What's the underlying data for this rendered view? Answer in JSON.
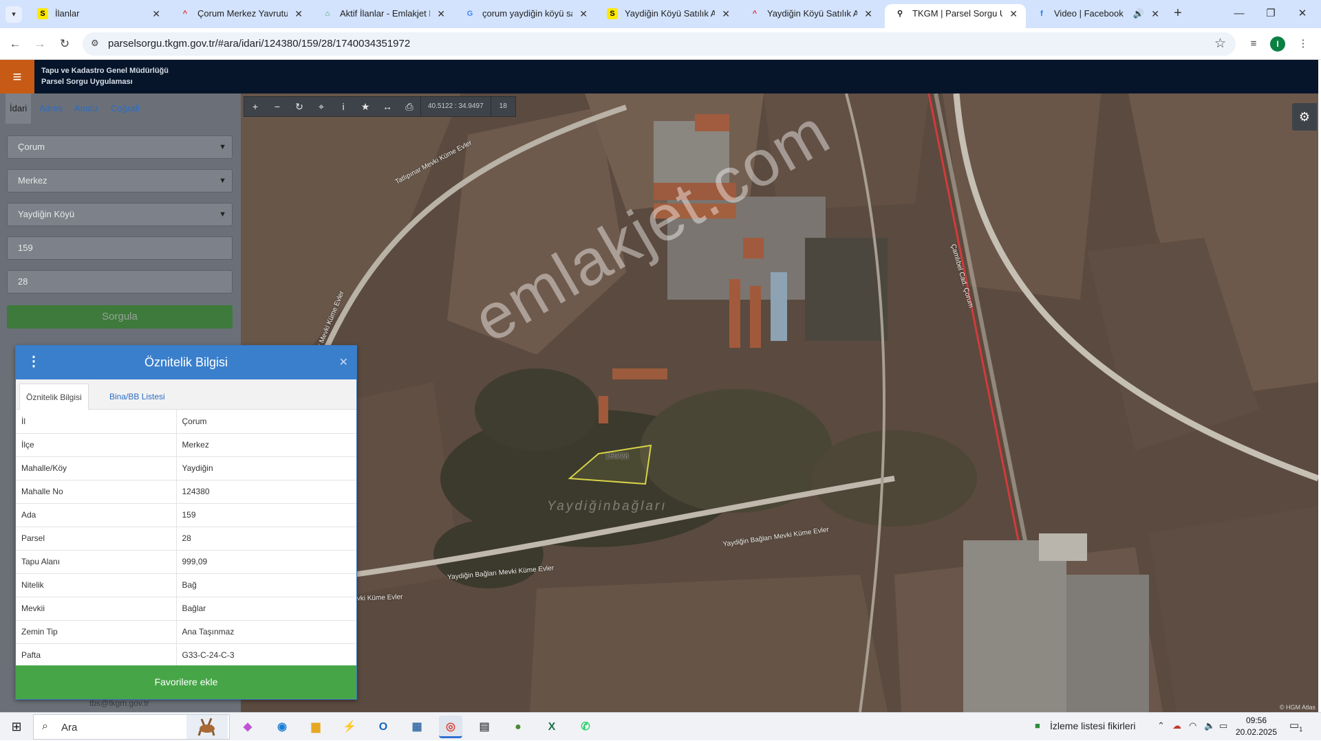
{
  "browser": {
    "tabs": [
      {
        "title": "İlanlar",
        "favicon": "sahibinden-icon",
        "fav_letter": "S",
        "fav_color": "#ffe800"
      },
      {
        "title": "Çorum Merkez Yavruturna",
        "favicon": "hepsiemlak-icon",
        "fav_letter": "^",
        "fav_color": "#e3262d"
      },
      {
        "title": "Aktif İlanlar - Emlakjet Par",
        "favicon": "emlakjet-icon",
        "fav_letter": "⌂",
        "fav_color": "#2a9d3f"
      },
      {
        "title": "çorum yaydiğin köyü satı",
        "favicon": "google-icon",
        "fav_letter": "G",
        "fav_color": "#4285f4"
      },
      {
        "title": "Yaydiğin Köyü Satılık Arsa",
        "favicon": "sahibinden-icon",
        "fav_letter": "S",
        "fav_color": "#ffe800"
      },
      {
        "title": "Yaydiğin Köyü Satılık Arsa",
        "favicon": "hepsiemlak-icon",
        "fav_letter": "^",
        "fav_color": "#e3262d"
      },
      {
        "title": "TKGM | Parsel Sorgu Uyg",
        "favicon": "location-pin-icon",
        "fav_letter": "⚲",
        "fav_color": "#1a1a1a"
      },
      {
        "title": "Video | Facebook",
        "favicon": "facebook-icon",
        "fav_letter": "f",
        "fav_color": "#1877f2"
      }
    ],
    "active_tab_index": 6,
    "url": "parselsorgu.tkgm.gov.tr/#ara/idari/124380/159/28/1740034351972",
    "profile_initial": "I"
  },
  "app": {
    "title_line1": "Tapu ve Kadastro Genel Müdürlüğü",
    "title_line2": "Parsel Sorgu Uygulaması",
    "header_color": "#07152a",
    "accent_color": "#c75b16"
  },
  "left_panel": {
    "tabs": [
      "İdari",
      "Adres",
      "Analiz",
      "Coğrafi"
    ],
    "active_tab": "İdari",
    "il": "Çorum",
    "ilce": "Merkez",
    "mahalle": "Yaydiğin Köyü",
    "ada": "159",
    "parsel": "28",
    "query_button": "Sorgula",
    "footer_link": "tbs@tkgm.gov.tr"
  },
  "map": {
    "coordinates": "40.5122 : 34.9497",
    "zoom": "18",
    "watermark": "emlakjet.com",
    "parcel_label": "159/28",
    "place_label": "Yaydiğinbağları",
    "roads": [
      "Tatlıpınar Mevki Küme Evler",
      "Yaydiğin Bağları Mevki Küme Evler",
      "Çamlıbel Cad. Çorum",
      "Yaydiğin Bağları Mevki Küme Evler",
      "Yaydiğin Bağları Mevki Küme Evler",
      "Tatlıpınar Mevki Küme Evler"
    ],
    "attribution": "© HGM Atlas"
  },
  "popup": {
    "title": "Öznitelik Bilgisi",
    "tabs": [
      "Öznitelik Bilgisi",
      "Bina/BB Listesi"
    ],
    "rows": [
      {
        "key": "İl",
        "value": "Çorum"
      },
      {
        "key": "İlçe",
        "value": "Merkez"
      },
      {
        "key": "Mahalle/Köy",
        "value": "Yaydiğin"
      },
      {
        "key": "Mahalle No",
        "value": "124380"
      },
      {
        "key": "Ada",
        "value": "159"
      },
      {
        "key": "Parsel",
        "value": "28"
      },
      {
        "key": "Tapu Alanı",
        "value": "999,09"
      },
      {
        "key": "Nitelik",
        "value": "Bağ"
      },
      {
        "key": "Mevkii",
        "value": "Bağlar"
      },
      {
        "key": "Zemin Tip",
        "value": "Ana Taşınmaz"
      },
      {
        "key": "Pafta",
        "value": "G33-C-24-C-3"
      }
    ],
    "favorite_button": "Favorilere ekle",
    "header_color": "#3a7fcc",
    "button_color": "#46a547"
  },
  "taskbar": {
    "search_placeholder": "Ara",
    "news_text": "İzleme listesi fikirleri",
    "time": "09:56",
    "date": "20.02.2025",
    "notification_count": "1"
  }
}
